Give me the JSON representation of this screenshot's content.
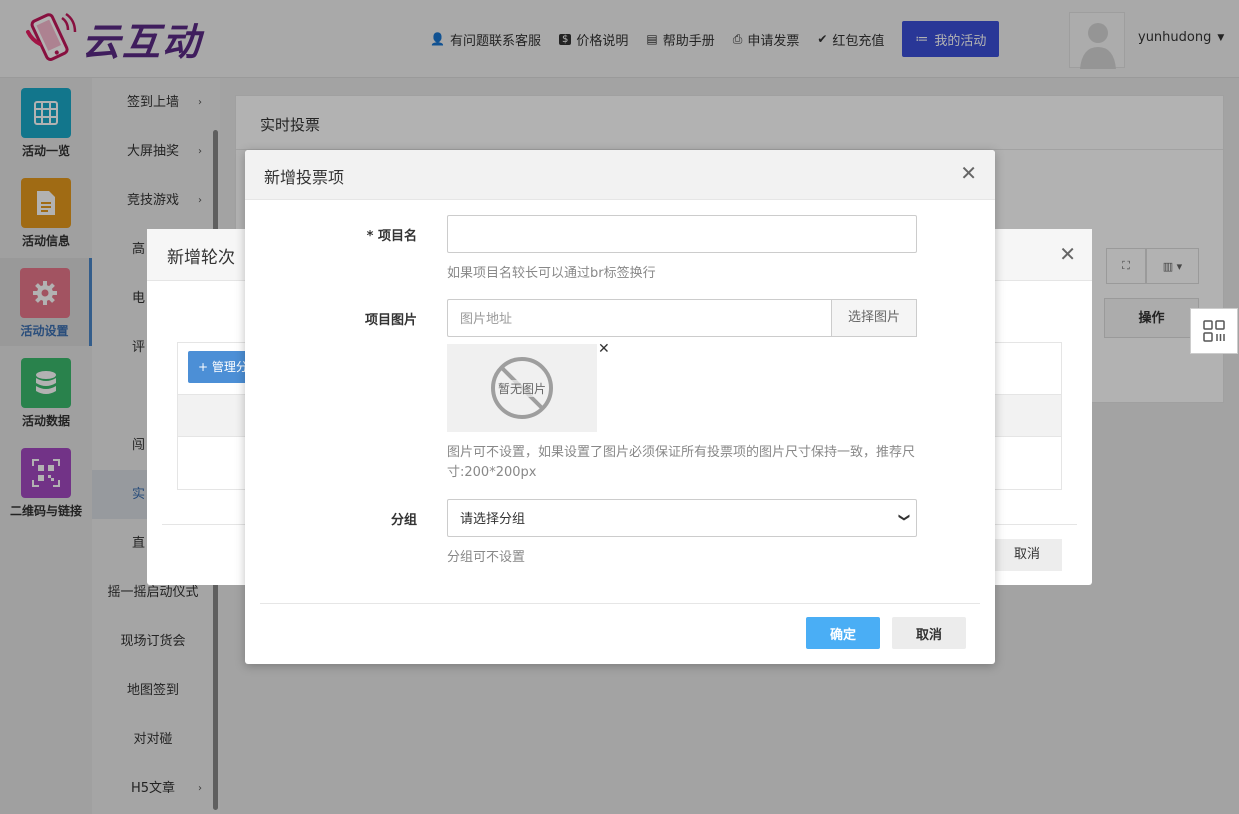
{
  "brand": {
    "name": "云互动"
  },
  "nav": [
    {
      "icon": "user-plus-icon",
      "glyph": "👤",
      "label": "有问题联系客服"
    },
    {
      "icon": "dollar-icon",
      "glyph": "$",
      "label": "价格说明"
    },
    {
      "icon": "book-icon",
      "glyph": "▤",
      "label": "帮助手册"
    },
    {
      "icon": "print-icon",
      "glyph": "⎙",
      "label": "申请发票"
    },
    {
      "icon": "shield-icon",
      "glyph": "✔",
      "label": "红包充值"
    }
  ],
  "my_activity": "我的活动",
  "user": {
    "name": "yunhudong"
  },
  "sidebar": [
    {
      "label": "活动一览",
      "color": "#1aa9c9",
      "icon": "grid-icon"
    },
    {
      "label": "活动信息",
      "color": "#e69a1e",
      "icon": "document-icon"
    },
    {
      "label": "活动设置",
      "color": "#e8778b",
      "icon": "gear-icon"
    },
    {
      "label": "活动数据",
      "color": "#3bba6e",
      "icon": "database-icon"
    },
    {
      "label": "二维码与链接",
      "color": "#a44ac2",
      "icon": "qrcode-icon"
    }
  ],
  "submenu": [
    {
      "label": "签到上墙",
      "arrow": "›"
    },
    {
      "label": "大屏抽奖",
      "arrow": "›"
    },
    {
      "label": "竞技游戏",
      "arrow": "›"
    },
    {
      "label": "高",
      "arrow": ""
    },
    {
      "label": "电",
      "arrow": ""
    },
    {
      "label": "评",
      "arrow": ""
    },
    {
      "label": "",
      "arrow": ""
    },
    {
      "label": "闯",
      "arrow": ""
    },
    {
      "label": "实",
      "arrow": ""
    },
    {
      "label": "直",
      "arrow": ""
    },
    {
      "label": "摇一摇启动仪式",
      "arrow": ""
    },
    {
      "label": "现场订货会",
      "arrow": ""
    },
    {
      "label": "地图签到",
      "arrow": ""
    },
    {
      "label": "对对碰",
      "arrow": ""
    },
    {
      "label": "H5文章",
      "arrow": "›"
    }
  ],
  "panel": {
    "title": "实时投票",
    "op_header": "操作"
  },
  "back_dialog": {
    "title": "新增轮次",
    "manage_btn": "+ 管理分",
    "cancel": "取消"
  },
  "dialog": {
    "title": "新增投票项",
    "name_label": "* 项目名",
    "name_value": "",
    "name_help": "如果项目名较长可以通过br标签换行",
    "image_label": "项目图片",
    "image_placeholder": "图片地址",
    "image_pick": "选择图片",
    "no_image": "暂无图片",
    "image_help": "图片可不设置，如果设置了图片必须保证所有投票项的图片尺寸保持一致，推荐尺寸:200*200px",
    "group_label": "分组",
    "group_selected": "请选择分组",
    "group_help": "分组可不设置",
    "ok": "确定",
    "cancel": "取消"
  },
  "colors": {
    "primary_btn": "#4aaef5",
    "my_activity_btn": "#3b4fd8",
    "logo_text": "#5b2a86"
  }
}
